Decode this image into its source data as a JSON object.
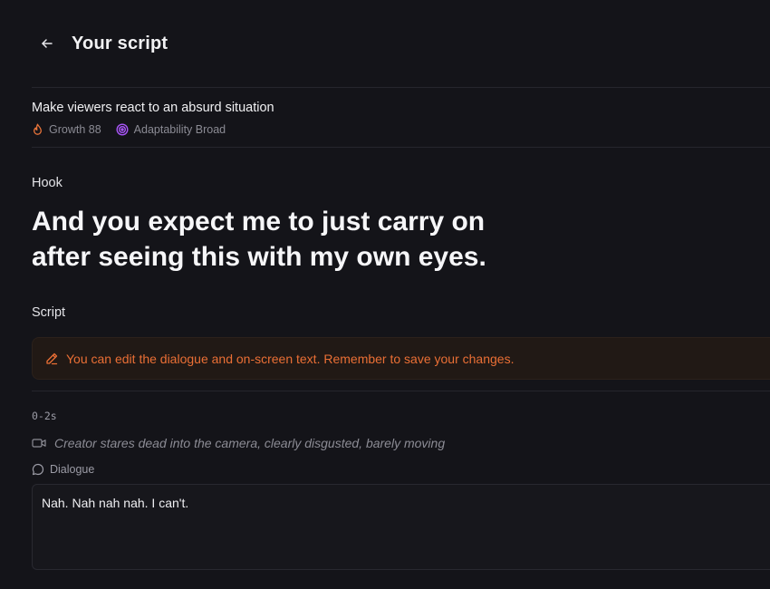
{
  "header": {
    "back_icon": "arrow-left-icon",
    "title": "Your script"
  },
  "concept": {
    "title": "Make viewers react to an absurd situation",
    "growth": {
      "icon": "flame-icon",
      "label": "Growth 88",
      "color": "#e8743a"
    },
    "adaptability": {
      "icon": "target-icon",
      "label": "Adaptability Broad",
      "color": "#a855f7"
    }
  },
  "hook": {
    "label": "Hook",
    "text": "And you expect me to just carry on after seeing this with my own eyes."
  },
  "script": {
    "label": "Script",
    "notice": {
      "icon": "pencil-icon",
      "text": "You can edit the dialogue and on-screen text. Remember to save your changes.",
      "color": "#ea6f35"
    },
    "segments": [
      {
        "time": "0-2s",
        "scene_icon": "video-camera-icon",
        "scene": "Creator stares dead into the camera, clearly disgusted, barely moving",
        "dialogue_icon": "speech-bubble-icon",
        "dialogue_label": "Dialogue",
        "dialogue": "Nah. Nah nah nah. I can't."
      }
    ]
  }
}
